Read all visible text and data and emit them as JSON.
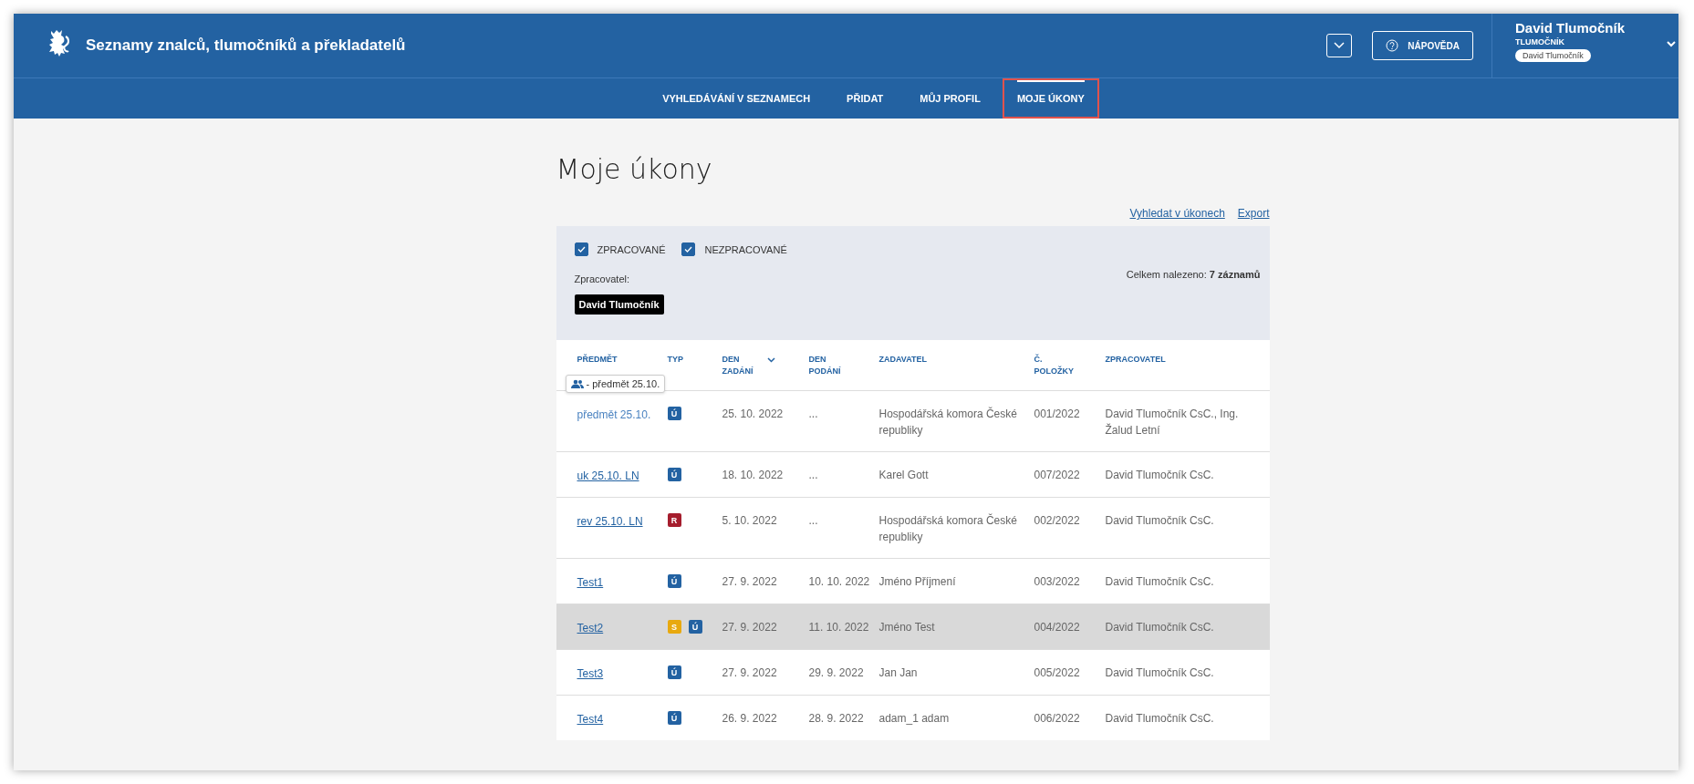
{
  "header": {
    "title": "Seznamy znalců, tlumočníků a překladatelů",
    "help_button": "NÁPOVĚDA",
    "user": {
      "name": "David Tlumočník",
      "role": "TLUMOČNÍK",
      "chip": "David Tlumočník"
    }
  },
  "tabs": [
    {
      "label": "VYHLEDÁVÁNÍ V SEZNAMECH",
      "selected": false
    },
    {
      "label": "PŘIDAT",
      "selected": false
    },
    {
      "label": "MŮJ PROFIL",
      "selected": false
    },
    {
      "label": "MOJE ÚKONY",
      "selected": true
    }
  ],
  "page_title": "Moje úkony",
  "links": [
    "Vyhledat v úkonech",
    "Export"
  ],
  "filters": {
    "checkboxes": [
      {
        "label": "ZPRACOVANÉ",
        "checked": true
      },
      {
        "label": "NEZPRACOVANÉ",
        "checked": true
      }
    ],
    "processor_label": "Zpracovatel:",
    "processor_chip": "David Tlumočník",
    "total": "Celkem nalezeno: **7 záznamů**"
  },
  "table": {
    "columns": [
      {
        "label": "PŘEDMĚT"
      },
      {
        "label": "TYP"
      },
      {
        "label": "DEN ZADÁNÍ",
        "sorted": true
      },
      {
        "label": "DEN PODÁNÍ"
      },
      {
        "label": "ZADAVATEL"
      },
      {
        "label": "Č. POLOŽKY"
      },
      {
        "label": "ZPRACOVATEL"
      }
    ],
    "tooltip": "- předmět 25.10.",
    "rows": [
      {
        "subject": "předmět 25.10.",
        "hovered": true,
        "selected": false,
        "types": [
          {
            "letter": "Ú",
            "color": "#2362a2"
          }
        ],
        "assigned": "25. 10. 2022",
        "submitted": "...",
        "client": "Hospodářská komora České republiky",
        "item": "001/2022",
        "processor": "David Tlumočník CsC., Ing. Žalud Letní"
      },
      {
        "subject": "uk 25.10. LN",
        "hovered": false,
        "selected": false,
        "types": [
          {
            "letter": "Ú",
            "color": "#2362a2"
          }
        ],
        "assigned": "18. 10. 2022",
        "submitted": "...",
        "client": "Karel Gott",
        "item": "007/2022",
        "processor": "David Tlumočník CsC."
      },
      {
        "subject": "rev 25.10. LN",
        "hovered": false,
        "selected": false,
        "types": [
          {
            "letter": "R",
            "color": "#a51d2d"
          }
        ],
        "assigned": "5. 10. 2022",
        "submitted": "...",
        "client": "Hospodářská komora České republiky",
        "item": "002/2022",
        "processor": "David Tlumočník CsC."
      },
      {
        "subject": "Test1",
        "hovered": false,
        "selected": false,
        "types": [
          {
            "letter": "Ú",
            "color": "#2362a2"
          }
        ],
        "assigned": "27. 9. 2022",
        "submitted": "10. 10. 2022",
        "client": "Jméno Příjmení",
        "item": "003/2022",
        "processor": "David Tlumočník CsC."
      },
      {
        "subject": "Test2",
        "hovered": false,
        "selected": true,
        "types": [
          {
            "letter": "S",
            "color": "#e8a90f"
          },
          {
            "letter": "Ú",
            "color": "#2362a2"
          }
        ],
        "assigned": "27. 9. 2022",
        "submitted": "11. 10. 2022",
        "client": "Jméno Test",
        "item": "004/2022",
        "processor": "David Tlumočník CsC."
      },
      {
        "subject": "Test3",
        "hovered": false,
        "selected": false,
        "types": [
          {
            "letter": "Ú",
            "color": "#2362a2"
          }
        ],
        "assigned": "27. 9. 2022",
        "submitted": "29. 9. 2022",
        "client": "Jan Jan",
        "item": "005/2022",
        "processor": "David Tlumočník CsC."
      },
      {
        "subject": "Test4",
        "hovered": false,
        "selected": false,
        "types": [
          {
            "letter": "Ú",
            "color": "#2362a2"
          }
        ],
        "assigned": "26. 9. 2022",
        "submitted": "28. 9. 2022",
        "client": "adam_1 adam",
        "item": "006/2022",
        "processor": "David Tlumočník CsC."
      }
    ]
  }
}
